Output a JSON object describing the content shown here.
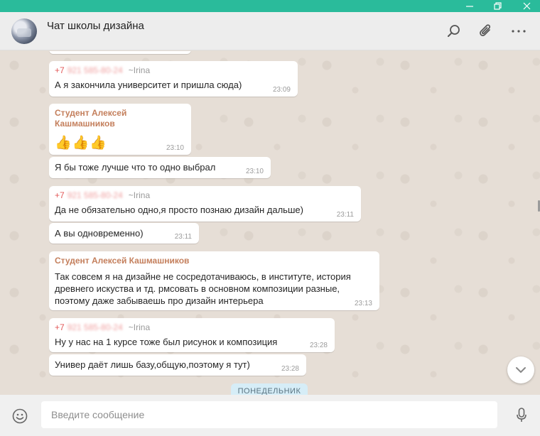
{
  "window": {
    "controls": [
      "minimize-icon",
      "restore-icon",
      "close-icon"
    ]
  },
  "header": {
    "chat_title": "Чат школы дизайна",
    "icons": [
      "search-icon",
      "paperclip-icon",
      "more-icon"
    ]
  },
  "messages": [
    {
      "type": "phone",
      "phone_visible": "+7",
      "phone_hidden": "921 585-80-24",
      "nick": "~Irina",
      "text": "А я закончила университет и пришла сюда)",
      "time": "23:09"
    },
    {
      "type": "named",
      "name": "Студент Алексей Кашмашников",
      "emoji": [
        "👍",
        "👍",
        "👍"
      ],
      "time": "23:10"
    },
    {
      "type": "continued",
      "text": "Я бы тоже лучше что то одно выбрал",
      "time": "23:10"
    },
    {
      "type": "phone",
      "phone_visible": "+7",
      "phone_hidden": "921 585-80-24",
      "nick": "~Irina",
      "text": "Да не обязательно одно,я просто познаю дизайн дальше)",
      "time": "23:11"
    },
    {
      "type": "continued",
      "text": "А вы одновременно)",
      "time": "23:11"
    },
    {
      "type": "named",
      "name": "Студент Алексей Кашмашников",
      "lines": [
        "Так совсем я на дизайне не сосредотачиваюсь, в институте, история",
        "древнего искуства и тд. рмсовать в основном композиции разные,",
        "поэтому даже забываешь про дизайн интерьера"
      ],
      "time": "23:13"
    },
    {
      "type": "phone",
      "phone_visible": "+7",
      "phone_hidden": "921 585-80-24",
      "nick": "~Irina",
      "text": "Ну у нас на 1 курсе тоже был рисунок и композиция",
      "time": "23:28"
    },
    {
      "type": "continued",
      "text": "Универ даёт лишь базу,общую,поэтому я тут)",
      "time": "23:28"
    }
  ],
  "date_divider": "ПОНЕДЕЛЬНИК",
  "composer": {
    "placeholder": "Введите сообщение",
    "value": ""
  },
  "colors": {
    "titlebar": "#2abb9b",
    "sender_name": "#c47f5c",
    "phone": "#e35a5a",
    "chat_bg": "#e6ded6"
  }
}
